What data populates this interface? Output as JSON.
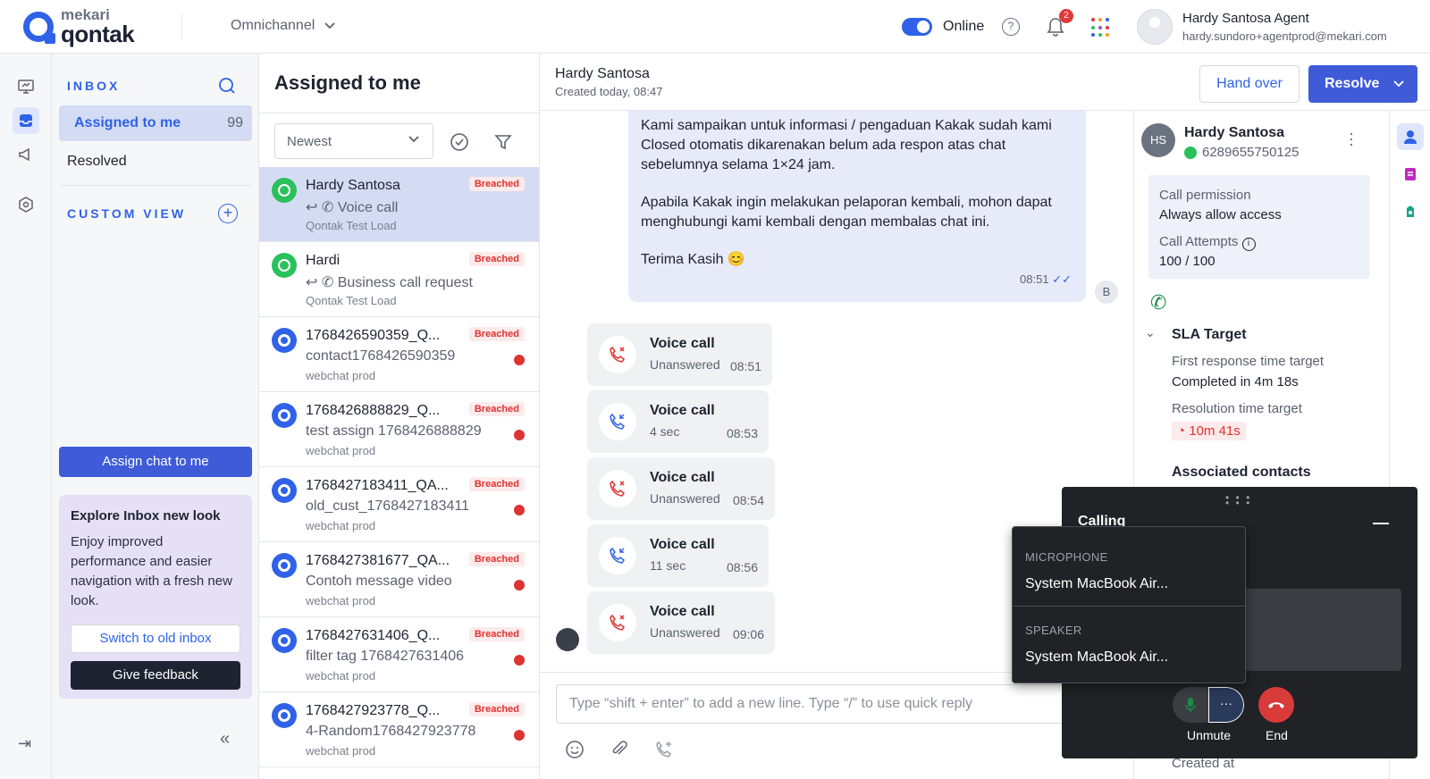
{
  "header": {
    "logo_small": "mekari",
    "logo_big": "qontak",
    "channel": "Omnichannel",
    "status": "Online",
    "notif_count": "2",
    "agent_name": "Hardy Santosa Agent",
    "agent_email": "hardy.sundoro+agentprod@mekari.com",
    "help": "?"
  },
  "inbox": {
    "title": "INBOX",
    "assigned_label": "Assigned to me",
    "assigned_count": "99",
    "resolved_label": "Resolved",
    "custom_view_title": "CUSTOM VIEW",
    "assign_button": "Assign chat to me",
    "explore_title": "Explore Inbox new look",
    "explore_body": "Enjoy improved performance and easier navigation with a fresh new look.",
    "switch_button": "Switch to old inbox",
    "feedback_button": "Give feedback"
  },
  "list": {
    "title": "Assigned to me",
    "sort": "Newest",
    "conversations": [
      {
        "name": "Hardy Santosa",
        "msg": "Voice call",
        "src": "Qontak Test Load",
        "badge": "Breached"
      },
      {
        "name": "Hardi",
        "msg": "Business call request",
        "src": "Qontak Test Load",
        "badge": "Breached"
      },
      {
        "name": "1768426590359_Q...",
        "msg": "contact1768426590359",
        "src": "webchat prod",
        "badge": "Breached"
      },
      {
        "name": "1768426888829_Q...",
        "msg": "test assign 1768426888829",
        "src": "webchat prod",
        "badge": "Breached"
      },
      {
        "name": "1768427183411_QA...",
        "msg": "old_cust_1768427183411",
        "src": "webchat prod",
        "badge": "Breached"
      },
      {
        "name": "1768427381677_QA...",
        "msg": "Contoh message video",
        "src": "webchat prod",
        "badge": "Breached"
      },
      {
        "name": "1768427631406_Q...",
        "msg": "filter tag 1768427631406",
        "src": "webchat prod",
        "badge": "Breached"
      },
      {
        "name": "1768427923778_Q...",
        "msg": "4-Random1768427923778",
        "src": "webchat prod",
        "badge": "Breached"
      }
    ]
  },
  "chat": {
    "name": "Hardy Santosa",
    "created": "Created today, 08:47",
    "handover": "Hand over",
    "resolve": "Resolve",
    "bubble_p1": "Kami sampaikan untuk informasi / pengaduan Kakak sudah kami Closed otomatis dikarenakan belum ada respon atas chat sebelumnya selama 1×24 jam.",
    "bubble_p2": "Apabila Kakak ingin melakukan pelaporan kembali, mohon dapat menghubungi kami kembali dengan membalas chat ini.",
    "bubble_p3": "Terima Kasih 😊",
    "bubble_time": "08:51",
    "bubble_avatar": "B",
    "calls": [
      {
        "title": "Voice call",
        "status": "Unanswered",
        "time": "08:51"
      },
      {
        "title": "Voice call",
        "status": "4 sec",
        "time": "08:53"
      },
      {
        "title": "Voice call",
        "status": "Unanswered",
        "time": "08:54"
      },
      {
        "title": "Voice call",
        "status": "11 sec",
        "time": "08:56"
      },
      {
        "title": "Voice call",
        "status": "Unanswered",
        "time": "09:06"
      }
    ],
    "composer_placeholder": "Type “shift + enter” to add a new line. Type “/” to use quick reply"
  },
  "contact": {
    "initials": "HS",
    "name": "Hardy Santosa",
    "phone": "6289655750125",
    "call_permission_label": "Call permission",
    "call_permission_value": "Always allow access",
    "call_attempts_label": "Call Attempts",
    "call_attempts_value": "100 / 100",
    "sla_title": "SLA Target",
    "first_response_label": "First response time target",
    "first_response_value": "Completed in 4m 18s",
    "resolution_label": "Resolution time target",
    "resolution_value": "10m 41s",
    "associated": "Associated contacts",
    "created_at": "Created at"
  },
  "calling": {
    "title": "Calling",
    "unmute": "Unmute",
    "end": "End",
    "more": "···",
    "microphone_label": "MICROPHONE",
    "microphone_value": "System MacBook Air...",
    "speaker_label": "SPEAKER",
    "speaker_value": "System MacBook Air..."
  },
  "colors": {
    "primary": "#2f62e8",
    "primary_btn": "#3f5bd8",
    "breach_red": "#d33",
    "whatsapp_green": "#29c15b"
  }
}
